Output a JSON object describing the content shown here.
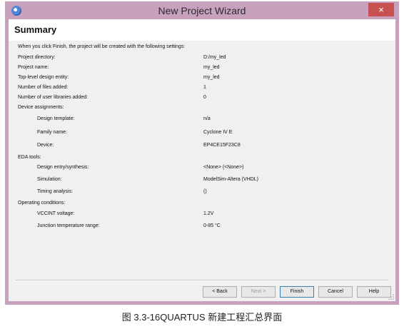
{
  "window": {
    "title": "New Project Wizard",
    "close_glyph": "×",
    "accent": "#c8a1bf",
    "close_color": "#c75050"
  },
  "summary": {
    "heading": "Summary",
    "description": "When you click Finish, the project will be created with the following settings:",
    "project_directory": {
      "label": "Project directory:",
      "value": "D:/my_led"
    },
    "project_name": {
      "label": "Project name:",
      "value": "my_led"
    },
    "top_level": {
      "label": "Top-level design entity:",
      "value": "my_led"
    },
    "files_added": {
      "label": "Number of files added:",
      "value": "1"
    },
    "libraries_added": {
      "label": "Number of user libraries added:",
      "value": "0"
    },
    "device_assignments": {
      "label": "Device assignments:"
    },
    "design_template": {
      "label": "Design template:",
      "value": "n/a"
    },
    "family_name": {
      "label": "Family name:",
      "value": "Cyclone IV E"
    },
    "device": {
      "label": "Device:",
      "value": "EP4CE15F23C8"
    },
    "eda_tools": {
      "label": "EDA tools:"
    },
    "design_entry": {
      "label": "Design entry/synthesis:",
      "value": "<None> (<None>)"
    },
    "simulation": {
      "label": "Simulation:",
      "value": "ModelSim-Altera (VHDL)"
    },
    "timing_analysis": {
      "label": "Timing analysis:",
      "value": "()"
    },
    "operating_conditions": {
      "label": "Operating conditions:"
    },
    "vccint": {
      "label": "VCCINT voltage:",
      "value": "1.2V"
    },
    "junction_temp": {
      "label": "Junction temperature range:",
      "value": "0-85 °C"
    }
  },
  "buttons": {
    "back": "< Back",
    "next": "Next >",
    "finish": "Finish",
    "cancel": "Cancel",
    "help": "Help"
  },
  "caption": "图 3.3-16QUARTUS 新建工程汇总界面"
}
